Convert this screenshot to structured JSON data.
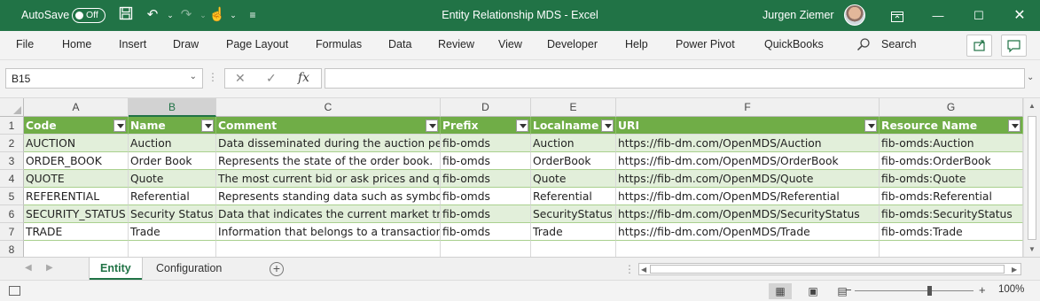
{
  "titlebar": {
    "autosave_label": "AutoSave",
    "autosave_state": "Off",
    "window_title": "Entity Relationship MDS  -  Excel",
    "user_name": "Jurgen Ziemer"
  },
  "ribbon": {
    "tabs": [
      "File",
      "Home",
      "Insert",
      "Draw",
      "Page Layout",
      "Formulas",
      "Data",
      "Review",
      "View",
      "Developer",
      "Help",
      "Power Pivot",
      "QuickBooks"
    ],
    "search_label": "Search"
  },
  "formula_bar": {
    "name_box": "B15",
    "fx_label": "fx",
    "formula": ""
  },
  "columns": [
    "A",
    "B",
    "C",
    "D",
    "E",
    "F",
    "G"
  ],
  "selected_column": "B",
  "rows": [
    "1",
    "2",
    "3",
    "4",
    "5",
    "6",
    "7",
    "8"
  ],
  "table": {
    "headers": [
      "Code",
      "Name",
      "Comment",
      "Prefix",
      "Localname",
      "URI",
      "Resource Name"
    ],
    "data": [
      [
        "AUCTION",
        "Auction",
        "Data disseminated during the auction pe",
        "fib-omds",
        "Auction",
        "https://fib-dm.com/OpenMDS/Auction",
        "fib-omds:Auction"
      ],
      [
        "ORDER_BOOK",
        "Order Book",
        "Represents the state of the order book.",
        "fib-omds",
        "OrderBook",
        "https://fib-dm.com/OpenMDS/OrderBook",
        "fib-omds:OrderBook"
      ],
      [
        "QUOTE",
        "Quote",
        "The most current bid or ask prices and qu",
        "fib-omds",
        "Quote",
        "https://fib-dm.com/OpenMDS/Quote",
        "fib-omds:Quote"
      ],
      [
        "REFERENTIAL",
        "Referential",
        "Represents standing data such as symbol",
        "fib-omds",
        "Referential",
        "https://fib-dm.com/OpenMDS/Referential",
        "fib-omds:Referential"
      ],
      [
        "SECURITY_STATUS",
        "Security Status",
        "Data that indicates the current market tra",
        "fib-omds",
        "SecurityStatus",
        "https://fib-dm.com/OpenMDS/SecurityStatus",
        "fib-omds:SecurityStatus"
      ],
      [
        "TRADE",
        "Trade",
        "Information that belongs to a transaction",
        "fib-omds",
        "Trade",
        "https://fib-dm.com/OpenMDS/Trade",
        "fib-omds:Trade"
      ]
    ]
  },
  "sheets": [
    "Entity",
    "Configuration"
  ],
  "active_sheet": "Entity",
  "status": {
    "zoom": "100%"
  },
  "colors": {
    "brand": "#217346",
    "table_header": "#70ad47",
    "table_band": "#e2efda"
  }
}
